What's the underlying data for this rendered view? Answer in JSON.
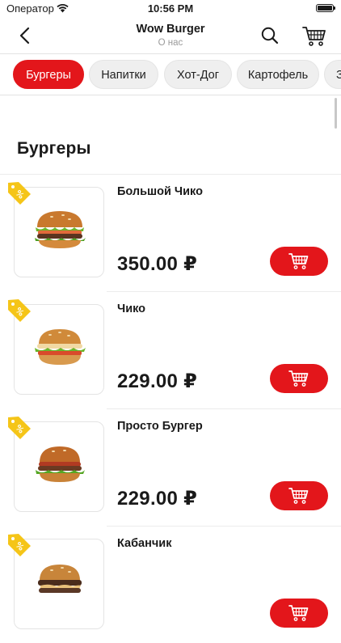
{
  "status_bar": {
    "carrier": "Оператор",
    "time": "10:56 PM"
  },
  "nav": {
    "title": "Wow Burger",
    "subtitle": "О нас"
  },
  "tabs": [
    {
      "label": "Бургеры",
      "active": true
    },
    {
      "label": "Напитки",
      "active": false
    },
    {
      "label": "Хот-Дог",
      "active": false
    },
    {
      "label": "Картофель",
      "active": false
    },
    {
      "label": "З",
      "active": false
    }
  ],
  "section": {
    "title": "Бургеры"
  },
  "products": [
    {
      "name": "Большой Чико",
      "price": "350.00 ₽",
      "badge_icon": "discount-tag-icon"
    },
    {
      "name": "Чико",
      "price": "229.00 ₽",
      "badge_icon": "discount-tag-icon"
    },
    {
      "name": "Просто Бургер",
      "price": "229.00 ₽",
      "badge_icon": "discount-tag-icon"
    },
    {
      "name": "Кабанчик",
      "price": "",
      "badge_icon": "discount-tag-icon"
    }
  ],
  "colors": {
    "accent": "#e3161b",
    "badge": "#f5c518",
    "muted_text": "#9a9a9a"
  }
}
